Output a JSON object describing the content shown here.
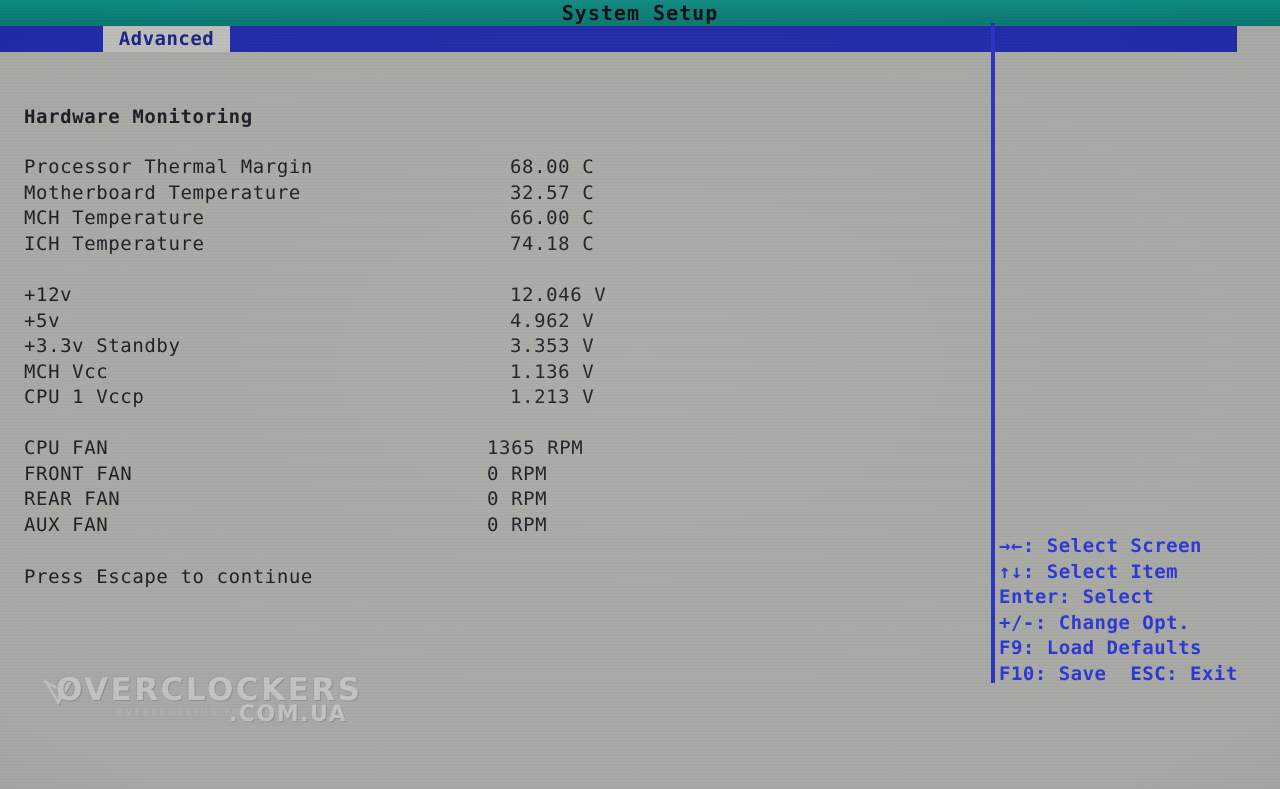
{
  "window": {
    "title": "System Setup"
  },
  "menu": {
    "tabs": [
      {
        "label": "Advanced",
        "selected": true
      }
    ]
  },
  "main": {
    "section_heading": "Hardware Monitoring",
    "footer_note": "Press Escape to continue",
    "groups": [
      {
        "id": "temperatures",
        "rows": [
          {
            "label": "Processor Thermal Margin",
            "value": "68.00 C"
          },
          {
            "label": "Motherboard Temperature",
            "value": "32.57 C"
          },
          {
            "label": "MCH Temperature",
            "value": "66.00 C"
          },
          {
            "label": "ICH Temperature",
            "value": "74.18 C"
          }
        ]
      },
      {
        "id": "voltages",
        "rows": [
          {
            "label": "+12v",
            "value": "12.046 V"
          },
          {
            "label": "+5v",
            "value": "4.962 V"
          },
          {
            "label": "+3.3v Standby",
            "value": "3.353 V"
          },
          {
            "label": "MCH Vcc",
            "value": "1.136 V"
          },
          {
            "label": "CPU 1 Vccp",
            "value": "1.213 V"
          }
        ]
      },
      {
        "id": "fans",
        "rows": [
          {
            "label": "CPU FAN",
            "value": "1365 RPM"
          },
          {
            "label": "FRONT FAN",
            "value": "0 RPM"
          },
          {
            "label": "REAR FAN",
            "value": "0 RPM"
          },
          {
            "label": "AUX FAN",
            "value": "0 RPM"
          }
        ]
      }
    ]
  },
  "help": {
    "lines": [
      "→←: Select Screen",
      "↑↓: Select Item",
      "Enter: Select",
      "+/-: Change Opt.",
      "F9: Load Defaults",
      "F10: Save  ESC: Exit"
    ]
  },
  "watermark": {
    "glyph": "⮛",
    "main": "OVERCLOCKERS",
    "domain": ".COM.UA",
    "tagline": "OVERCLOCKING FOR ALL"
  },
  "colors": {
    "title_bar": "#0a7d76",
    "menu_bar": "#1f2aa6",
    "tab_background": "#bcbdb8",
    "tab_text": "#1b2288",
    "body_background": "#a7a8a4",
    "body_text": "#1a1d22",
    "help_text": "#2b36d4",
    "divider": "#2b31c0"
  }
}
